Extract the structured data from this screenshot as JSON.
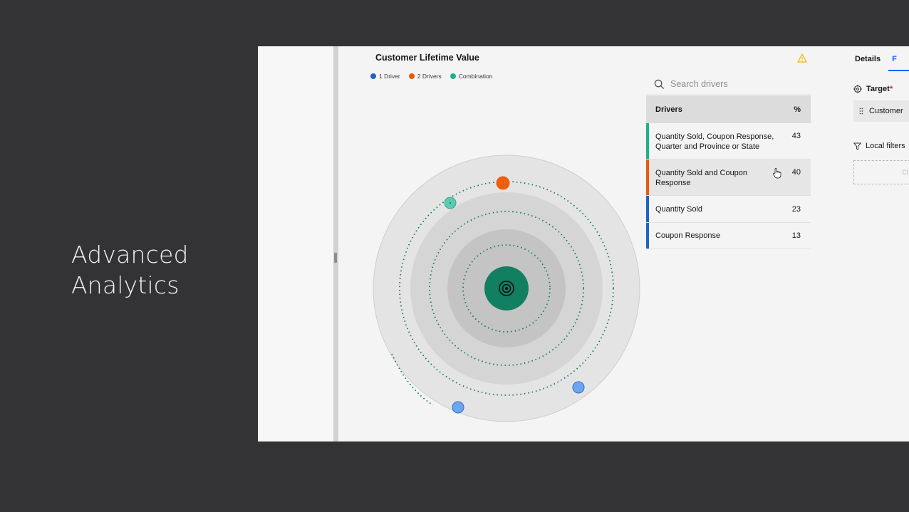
{
  "slide": {
    "title_line1": "Advanced",
    "title_line2": "Analytics"
  },
  "visualization": {
    "title": "Customer Lifetime Value",
    "legend": [
      {
        "label": "1 Driver",
        "color": "#1f63c4"
      },
      {
        "label": "2 Drivers",
        "color": "#e8590c"
      },
      {
        "label": "Combination",
        "color": "#20b08d"
      }
    ],
    "warning_icon": "warning-triangle-icon"
  },
  "drivers_panel": {
    "search_placeholder": "Search drivers",
    "header_label": "Drivers",
    "header_pct": "%",
    "rows": [
      {
        "label": "Quantity Sold, Coupon Response, Quarter and Province or State",
        "pct": "43",
        "color": "#20b08d"
      },
      {
        "label": "Quantity Sold and Coupon Response",
        "pct": "40",
        "color": "#e8590c"
      },
      {
        "label": "Quantity Sold",
        "pct": "23",
        "color": "#1f63c4"
      },
      {
        "label": "Coupon Response",
        "pct": "13",
        "color": "#1f63c4"
      }
    ]
  },
  "side_panel": {
    "tab_details": "Details",
    "tab_second": "F",
    "target_label": "Target",
    "target_required": "*",
    "target_value": "Customer",
    "filters_label": "Local filters",
    "drop_zone_text": "Cl"
  }
}
